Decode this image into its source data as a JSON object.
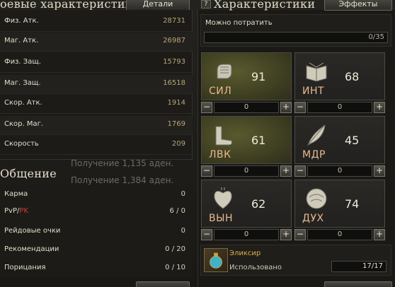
{
  "left_panel": {
    "title_combat": "оевые характеристики",
    "details_button": "Детали",
    "stats": [
      {
        "label": "Физ. Атк.",
        "value": "28731"
      },
      {
        "label": "Маг. Атк.",
        "value": "26987"
      },
      {
        "label": "Физ. Защ.",
        "value": "15793"
      },
      {
        "label": "Маг. Защ.",
        "value": "16518"
      },
      {
        "label": "Скор. Атк.",
        "value": "1914"
      },
      {
        "label": "Скор. Маг.",
        "value": "1769"
      },
      {
        "label": "Скорость",
        "value": "209"
      }
    ],
    "title_social": "Общение",
    "social": {
      "karma_label": "Карма",
      "karma_value": "0",
      "pvp_label": "PvP/",
      "pk_label": "PK",
      "pvp_value": "6 / 0",
      "raid_label": "Рейдовые очки",
      "raid_value": "0",
      "rec_label": "Рекомендации",
      "rec_value": "0 / 20",
      "blame_label": "Порицания",
      "blame_value": "0 / 10"
    }
  },
  "background_chat": [
    "Получение 1,135 аден.",
    "Получение 1,384 аден."
  ],
  "right_panel": {
    "help_icon": "?",
    "title": "Характеристики",
    "effects_button": "Эффекты",
    "spend_label": "Можно потратить",
    "spend_value": "0/35",
    "cards": [
      {
        "abbr": "СИЛ",
        "value": "91",
        "field": "0",
        "icon": "fist-icon",
        "highlight": true
      },
      {
        "abbr": "ИНТ",
        "value": "68",
        "field": "0",
        "icon": "book-icon",
        "highlight": false
      },
      {
        "abbr": "ЛВК",
        "value": "61",
        "field": "0",
        "icon": "foot-icon",
        "highlight": true
      },
      {
        "abbr": "МДР",
        "value": "45",
        "field": "0",
        "icon": "feather-icon",
        "highlight": false
      },
      {
        "abbr": "ВЫН",
        "value": "62",
        "field": "0",
        "icon": "heart-icon",
        "highlight": false
      },
      {
        "abbr": "ДУХ",
        "value": "74",
        "field": "0",
        "icon": "brain-icon",
        "highlight": false
      }
    ],
    "minus": "−",
    "plus": "+",
    "elixir_name": "Эликсир",
    "elixir_used_label": "Использовано",
    "elixir_value": "17/17"
  },
  "colors": {
    "accent_gold": "#e0b347",
    "stat_value": "#b9a579",
    "pk_red": "#d23a2d",
    "abbr": "#e9b98f"
  }
}
